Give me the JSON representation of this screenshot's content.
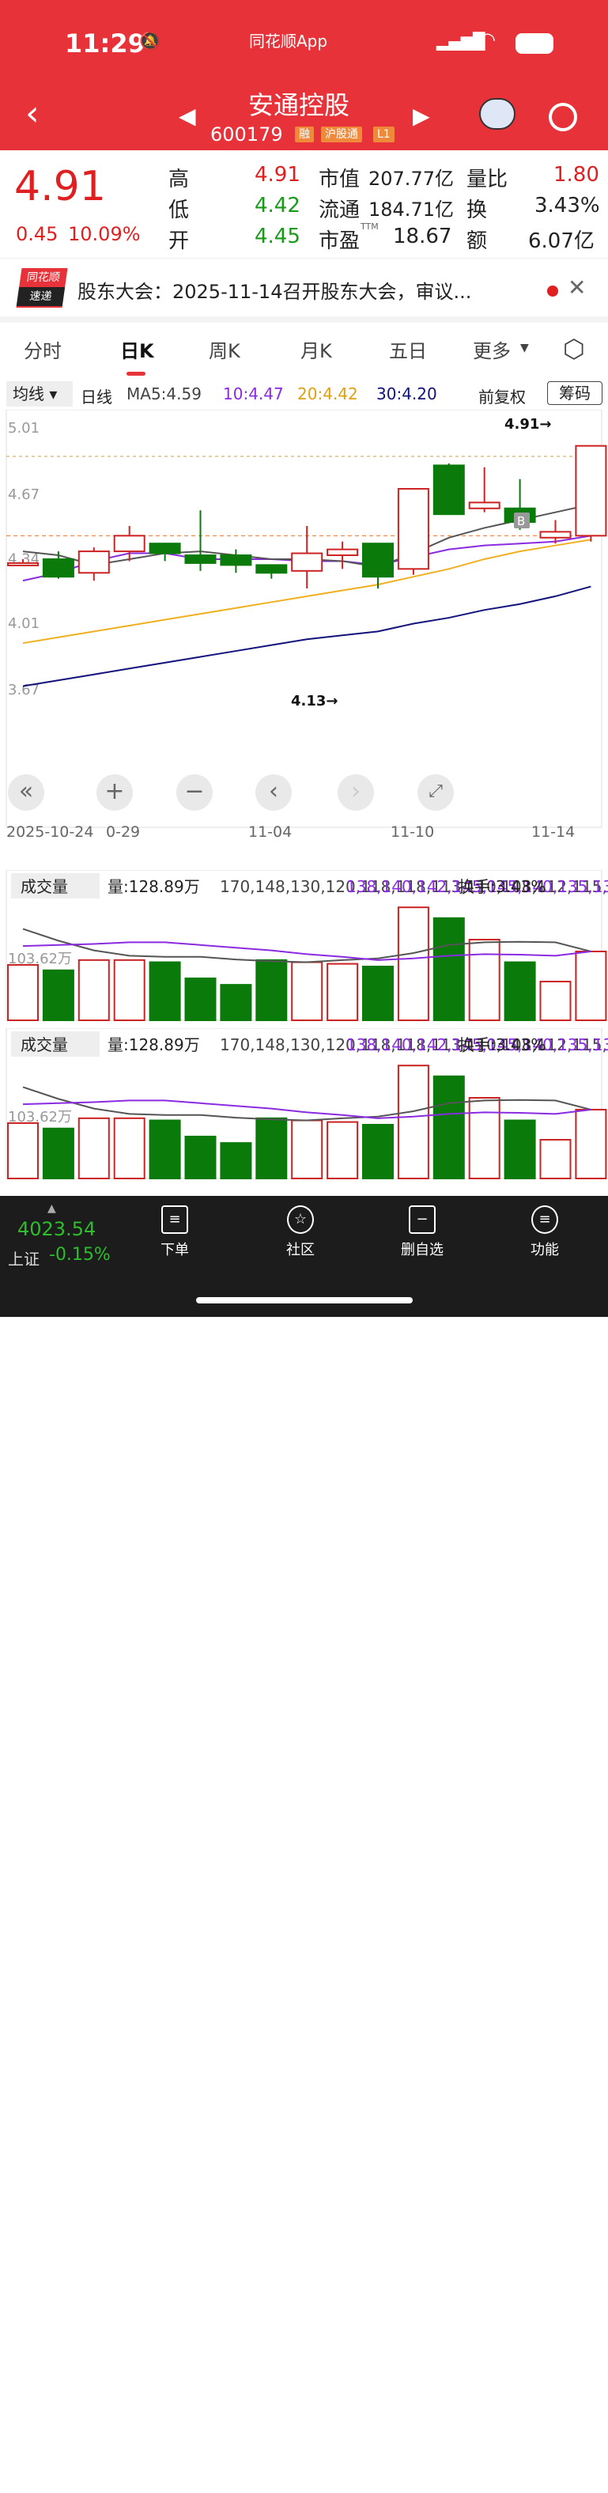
{
  "status": {
    "time": "11:29",
    "app": "同花顺App"
  },
  "header": {
    "name": "安通控股",
    "code": "600179",
    "badges": [
      "融",
      "沪股通",
      "L1"
    ]
  },
  "quote": {
    "price": "4.91",
    "change": "0.45",
    "pct": "10.09%",
    "rows": [
      [
        "高",
        "4.91",
        "市值",
        "207.77亿",
        "量比",
        "1.80"
      ],
      [
        "低",
        "4.42",
        "流通",
        "184.71亿",
        "换",
        "3.43%"
      ],
      [
        "开",
        "4.45",
        "市盈",
        "18.67",
        "额",
        "6.07亿"
      ]
    ],
    "ttm": "TTM"
  },
  "news": {
    "logo1": "同花顺",
    "logo2": "速递",
    "text": "股东大会：2025-11-14召开股东大会，审议..."
  },
  "tabs": [
    "分时",
    "日K",
    "周K",
    "月K",
    "五日",
    "更多"
  ],
  "ma_bar": {
    "type": "均线",
    "period": "日线",
    "ma5": "MA5:4.59",
    "ma10": "10:4.47",
    "ma20": "20:4.42",
    "ma30": "30:4.20",
    "adj": "前复权",
    "chips": "筹码"
  },
  "colors": {
    "up": "#cc2222",
    "down": "#0a7a0a",
    "ma5": "#555555",
    "ma10": "#8a2be2",
    "ma20": "#f0b020",
    "ma30": "#12127a",
    "brand": "#e8323a"
  },
  "chart_data": [
    {
      "type": "candlestick",
      "yticks": [
        "5.01",
        "4.67",
        "4.34",
        "4.01",
        "3.67"
      ],
      "xlabels": [
        "2025-10-24",
        "0-29",
        "11-04",
        "11-10",
        "11-14"
      ],
      "max_label": "4.91→",
      "min_label": "4.13→",
      "marker": "B",
      "candles": [
        [
          4.31,
          4.31,
          4.33,
          4.3
        ],
        [
          4.33,
          4.24,
          4.37,
          4.23
        ],
        [
          4.26,
          4.37,
          4.39,
          4.22
        ],
        [
          4.37,
          4.45,
          4.5,
          4.32
        ],
        [
          4.41,
          4.36,
          4.41,
          4.32
        ],
        [
          4.35,
          4.31,
          4.58,
          4.27
        ],
        [
          4.35,
          4.3,
          4.38,
          4.26
        ],
        [
          4.3,
          4.26,
          4.3,
          4.23
        ],
        [
          4.27,
          4.36,
          4.5,
          4.18
        ],
        [
          4.35,
          4.38,
          4.42,
          4.28
        ],
        [
          4.41,
          4.24,
          4.41,
          4.18
        ],
        [
          4.28,
          4.69,
          4.69,
          4.25
        ],
        [
          4.81,
          4.56,
          4.82,
          4.56
        ],
        [
          4.59,
          4.62,
          4.8,
          4.57
        ],
        [
          4.59,
          4.52,
          4.74,
          4.48
        ],
        [
          4.44,
          4.47,
          4.53,
          4.41
        ],
        [
          4.45,
          4.91,
          4.91,
          4.42
        ]
      ],
      "ma5": [
        4.37,
        4.35,
        4.3,
        4.33,
        4.36,
        4.37,
        4.35,
        4.33,
        4.33,
        4.32,
        4.29,
        4.36,
        4.44,
        4.49,
        4.53,
        4.57,
        4.61
      ],
      "ma10": [
        4.22,
        4.26,
        4.32,
        4.36,
        4.36,
        4.33,
        4.33,
        4.33,
        4.32,
        4.32,
        4.3,
        4.34,
        4.38,
        4.4,
        4.41,
        4.42,
        4.45
      ],
      "ma20": [
        3.9,
        3.93,
        3.96,
        3.99,
        4.02,
        4.05,
        4.08,
        4.11,
        4.14,
        4.17,
        4.2,
        4.24,
        4.28,
        4.33,
        4.37,
        4.4,
        4.43
      ],
      "ma30": [
        3.68,
        3.71,
        3.74,
        3.77,
        3.8,
        3.83,
        3.86,
        3.89,
        3.92,
        3.94,
        3.96,
        4.0,
        4.03,
        4.07,
        4.1,
        4.14,
        4.19
      ]
    },
    {
      "type": "bar",
      "label": "成交量",
      "vol": "量:128.89万",
      "ma5": [
        170,
        148,
        130,
        120,
        118,
        118,
        113,
        110,
        108,
        112,
        115,
        125,
        140,
        145,
        146,
        145,
        128
      ],
      "ma10": [
        138,
        140,
        142,
        145,
        145,
        140,
        135,
        130,
        123,
        118,
        112,
        115,
        120,
        123,
        122,
        120,
        128
      ],
      "turn": "换手:3.43%",
      "ref": "103.62万",
      "values": [
        103,
        93,
        112,
        112,
        108,
        78,
        66,
        112,
        108,
        105,
        100,
        210,
        190,
        150,
        108,
        72,
        128
      ]
    },
    {
      "type": "bar",
      "label": "成交量",
      "vol": "量:128.89万",
      "ma5": [
        170,
        148,
        130,
        120,
        118,
        118,
        113,
        110,
        108,
        112,
        115,
        125,
        140,
        145,
        146,
        145,
        128
      ],
      "ma10": [
        138,
        140,
        142,
        145,
        145,
        140,
        135,
        130,
        123,
        118,
        112,
        115,
        120,
        123,
        122,
        120,
        128
      ],
      "turn": "换手:3.43%",
      "ref": "103.62万",
      "values": [
        103,
        93,
        112,
        112,
        108,
        78,
        66,
        112,
        108,
        105,
        100,
        210,
        190,
        150,
        108,
        72,
        128
      ]
    }
  ],
  "index": {
    "value": "4023.54",
    "name": "上证",
    "chg": "-0.15%"
  },
  "nav": [
    "下单",
    "社区",
    "删自选",
    "功能"
  ]
}
